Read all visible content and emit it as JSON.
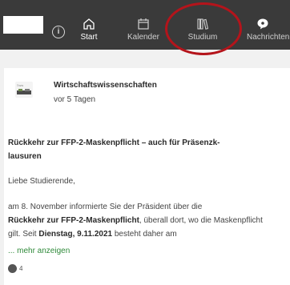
{
  "nav": {
    "items": [
      {
        "label": "Start",
        "icon": "home-icon"
      },
      {
        "label": "Kalender",
        "icon": "calendar-icon"
      },
      {
        "label": "Studium",
        "icon": "library-icon"
      },
      {
        "label": "Nachrichten",
        "icon": "chat-icon"
      }
    ],
    "highlight_color": "#b4141b"
  },
  "post": {
    "author": "Wirtschaftswissenschaften",
    "time": "vor 5 Tagen",
    "title": "Rückkehr zur FFP-2-Maskenpflicht – auch für Präsenzk-lausuren",
    "greeting": "Liebe Studierende,",
    "body": {
      "part1": "am 8. November informierte Sie der Präsident über die",
      "bold1": "Rückkehr zur FFP-2-Maskenpflicht",
      "part2": ", überall dort, wo die Maskenpflicht gilt. Seit",
      "bold2": "Dienstag, 9.11.2021",
      "part3": "besteht daher am"
    },
    "more_link": "... mehr anzeigen",
    "reaction_count": "4"
  },
  "colors": {
    "topbar": "#3a3a3a",
    "link": "#2f8a3a"
  }
}
